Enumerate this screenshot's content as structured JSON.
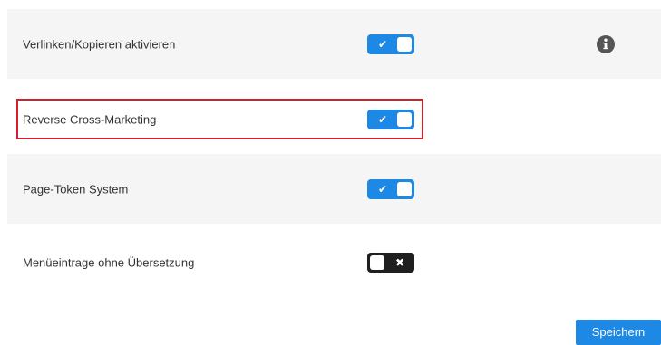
{
  "settings": [
    {
      "label": "Verlinken/Kopieren aktivieren",
      "state": "on",
      "mark": "✔",
      "has_info": true
    },
    {
      "label": "Reverse Cross-Marketing",
      "state": "on",
      "mark": "✔",
      "highlighted": true
    },
    {
      "label": "Page-Token System",
      "state": "on",
      "mark": "✔"
    },
    {
      "label": "Menüeintrage ohne Übersetzung",
      "state": "off",
      "mark": "✖"
    }
  ],
  "info_icon": "info-circle-icon",
  "highlight_color": "#d4202e",
  "accent_color": "#1e88e5",
  "save_button": {
    "label": "Speichern"
  }
}
